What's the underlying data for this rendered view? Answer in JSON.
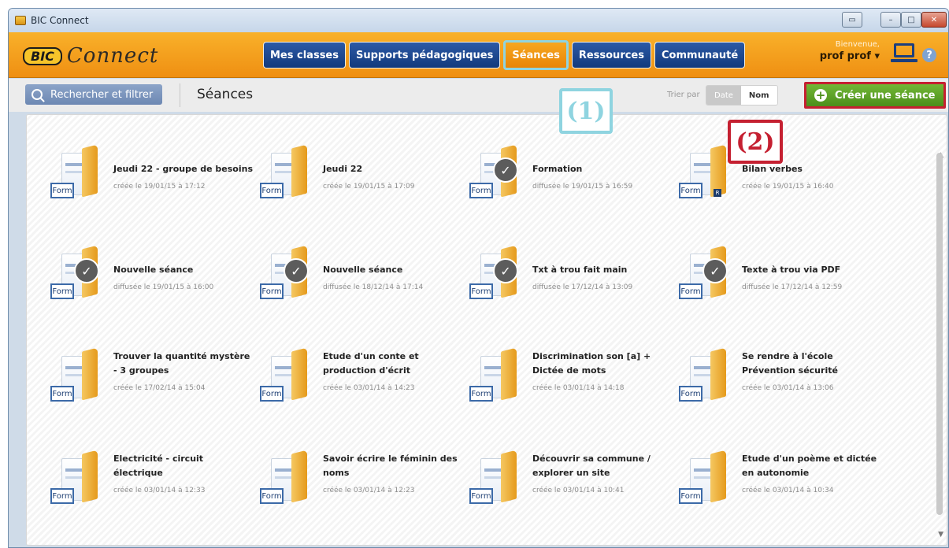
{
  "window": {
    "title": "BIC Connect"
  },
  "header": {
    "logo_bic": "BIC",
    "logo_connect": "Connect",
    "nav": [
      {
        "label": "Mes classes",
        "active": false
      },
      {
        "label": "Supports pédagogiques",
        "active": false
      },
      {
        "label": "Séances",
        "active": true
      },
      {
        "label": "Ressources",
        "active": false
      },
      {
        "label": "Communauté",
        "active": false
      }
    ],
    "welcome": "Bienvenue,",
    "user": "prof  prof",
    "help": "?"
  },
  "toolbar": {
    "search_label": "Rechercher et filtrer",
    "page_title": "Séances",
    "sort_label": "Trier par",
    "sort_options": [
      "Date",
      "Nom"
    ],
    "sort_selected": "Date",
    "create_label": "Créer une séance"
  },
  "annotations": {
    "one": "(1)",
    "two": "(2)"
  },
  "sessions": [
    {
      "title": "Jeudi 22 - groupe de besoins",
      "date": "créée le 19/01/15 à 17:12",
      "status": "created",
      "badge": "Form"
    },
    {
      "title": "Jeudi 22",
      "date": "créée le 19/01/15 à 17:09",
      "status": "created",
      "badge": "Form"
    },
    {
      "title": "Formation",
      "date": "diffusée le 19/01/15 à 16:59",
      "status": "published",
      "badge": "Form"
    },
    {
      "title": "Bilan verbes",
      "date": "créée le 19/01/15 à 16:40",
      "status": "created",
      "badge": "Form",
      "extra": "R"
    },
    {
      "title": "Nouvelle séance",
      "date": "diffusée le 19/01/15 à 16:00",
      "status": "published",
      "badge": "Form"
    },
    {
      "title": "Nouvelle séance",
      "date": "diffusée le 18/12/14 à 17:14",
      "status": "published",
      "badge": "Form"
    },
    {
      "title": "Txt à trou fait main",
      "date": "diffusée le 17/12/14 à 13:09",
      "status": "published",
      "badge": "Form"
    },
    {
      "title": "Texte à trou via PDF",
      "date": "diffusée le 17/12/14 à 12:59",
      "status": "published",
      "badge": "Form"
    },
    {
      "title": "Trouver la quantité mystère - 3 groupes",
      "date": "créée le 17/02/14 à 15:04",
      "status": "created",
      "badge": "Form"
    },
    {
      "title": "Etude d'un conte et production d'écrit",
      "date": "créée le 03/01/14 à 14:23",
      "status": "created",
      "badge": "Form"
    },
    {
      "title": "Discrimination son [a] + Dictée de mots",
      "date": "créée le 03/01/14 à 14:18",
      "status": "created",
      "badge": "Form"
    },
    {
      "title": "Se rendre à l'école Prévention sécurité",
      "date": "créée le 03/01/14 à 13:06",
      "status": "created",
      "badge": "Form"
    },
    {
      "title": "Electricité - circuit électrique",
      "date": "créée le 03/01/14 à 12:33",
      "status": "created",
      "badge": "Form"
    },
    {
      "title": "Savoir écrire le féminin des noms",
      "date": "créée le 03/01/14 à 12:23",
      "status": "created",
      "badge": "Form"
    },
    {
      "title": "Découvrir sa commune / explorer un site",
      "date": "créée le 03/01/14 à 10:41",
      "status": "created",
      "badge": "Form"
    },
    {
      "title": "Etude d'un poème et dictée en autonomie",
      "date": "créée le 03/01/14 à 10:34",
      "status": "created",
      "badge": "Form"
    }
  ]
}
